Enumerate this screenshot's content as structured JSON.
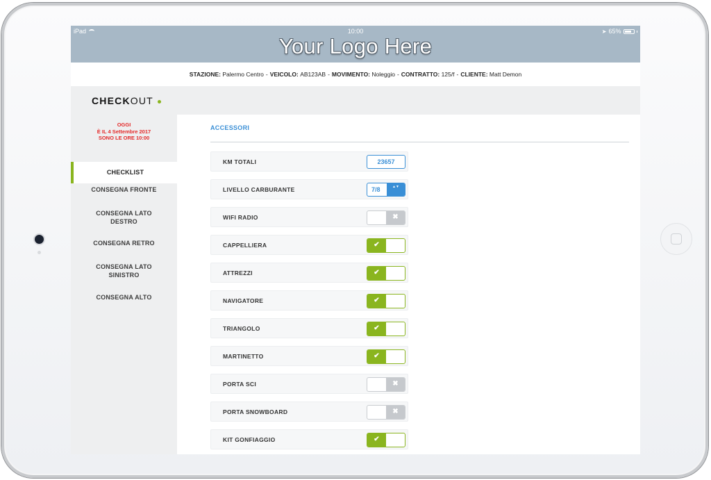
{
  "status_bar": {
    "device": "iPad",
    "time": "10:00",
    "battery": "65%"
  },
  "header": {
    "logo_text": "Your Logo Here"
  },
  "info_bar": [
    {
      "label": "STAZIONE:",
      "value": "Palermo Centro"
    },
    {
      "label": "VEICOLO:",
      "value": "AB123AB"
    },
    {
      "label": "MOVIMENTO:",
      "value": "Noleggio"
    },
    {
      "label": "CONTRATTO:",
      "value": "125/f"
    },
    {
      "label": "CLIENTE:",
      "value": "Matt Demon"
    }
  ],
  "info_separator": "-",
  "page": {
    "title_bold": "CHECK",
    "title_rest": "OUT"
  },
  "sidebar": {
    "today_lines": [
      "OGGI",
      "È IL 4 Settembre 2017",
      "SONO LE ORE 10:00"
    ],
    "items": [
      {
        "lines": [
          "CHECKLIST"
        ],
        "active": true
      },
      {
        "lines": [
          "CONSEGNA FRONTE"
        ],
        "active": false
      },
      {
        "lines": [
          "CONSEGNA LATO",
          "DESTRO"
        ],
        "active": false
      },
      {
        "lines": [
          "CONSEGNA RETRO"
        ],
        "active": false
      },
      {
        "lines": [
          "CONSEGNA LATO",
          "SINISTRO"
        ],
        "active": false
      },
      {
        "lines": [
          "CONSEGNA ALTO"
        ],
        "active": false
      }
    ]
  },
  "section": {
    "title": "ACCESSORI"
  },
  "rows": [
    {
      "label": "KM TOTALI",
      "control": "input",
      "value": "23657"
    },
    {
      "label": "LIVELLO CARBURANTE",
      "control": "select",
      "value": "7/8"
    },
    {
      "label": "WIFI RADIO",
      "control": "toggle",
      "checked": false
    },
    {
      "label": "CAPPELLIERA",
      "control": "toggle",
      "checked": true
    },
    {
      "label": "ATTREZZI",
      "control": "toggle",
      "checked": true
    },
    {
      "label": "NAVIGATORE",
      "control": "toggle",
      "checked": true
    },
    {
      "label": "TRIANGOLO",
      "control": "toggle",
      "checked": true
    },
    {
      "label": "MARTINETTO",
      "control": "toggle",
      "checked": true
    },
    {
      "label": "PORTA SCI",
      "control": "toggle",
      "checked": false
    },
    {
      "label": "PORTA SNOWBOARD",
      "control": "toggle",
      "checked": false
    },
    {
      "label": "KIT GONFIAGGIO",
      "control": "toggle",
      "checked": true
    }
  ],
  "icons": {
    "check": "✔",
    "cross": "✖",
    "select_arrows": "▲▼"
  },
  "colors": {
    "accent_green": "#8ab51f",
    "accent_blue": "#3a8fd6",
    "header_bg": "#a7b8c6",
    "alert_red": "#e42a2a"
  }
}
